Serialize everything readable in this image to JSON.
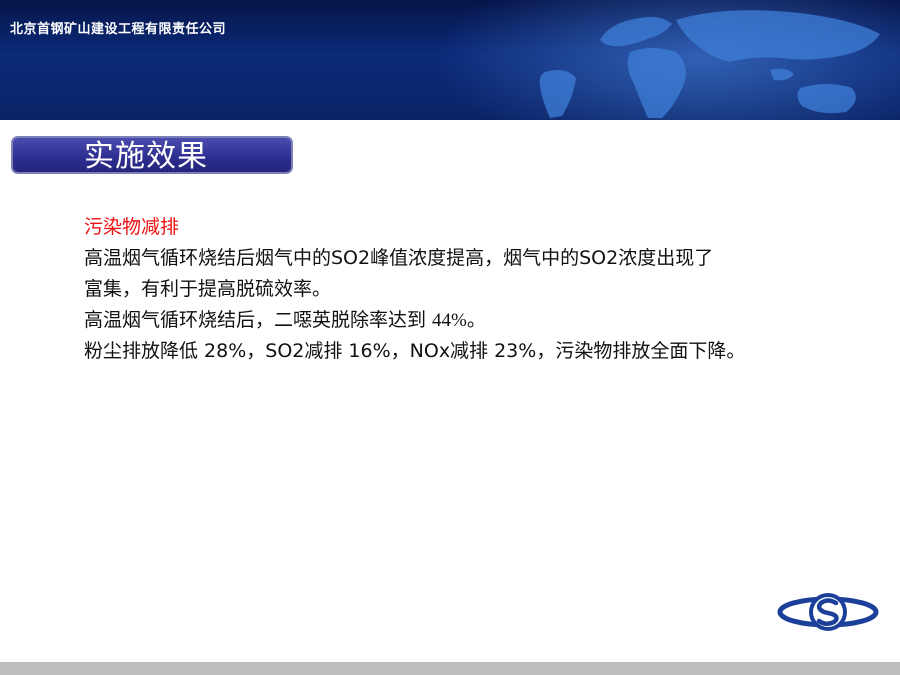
{
  "header": {
    "company_name": "北京首钢矿山建设工程有限责任公司"
  },
  "section": {
    "title": "实施效果"
  },
  "content": {
    "subheading": "污染物减排",
    "lines": [
      "高温烟气循环烧结后烟气中的SO2峰值浓度提高，烟气中的SO2浓度出现了",
      "富集，有利于提高脱硫效率。",
      "粉尘排放降低 28%，SO2减排 16%，NOx减排 23%，污染物排放全面下降。"
    ],
    "dioxin_line": {
      "prefix": "高温烟气循环烧结后，二噁英脱除率达到 ",
      "value": "44%",
      "suffix": "。"
    }
  },
  "colors": {
    "header_bg": "#0b2a78",
    "title_box": "#2e2f92",
    "subheading": "#ee1111",
    "footer_bar": "#bdbdbd",
    "logo_blue": "#1c3f9a"
  },
  "icons": {
    "logo": "company-logo-icon",
    "world_map": "world-map-decoration"
  }
}
